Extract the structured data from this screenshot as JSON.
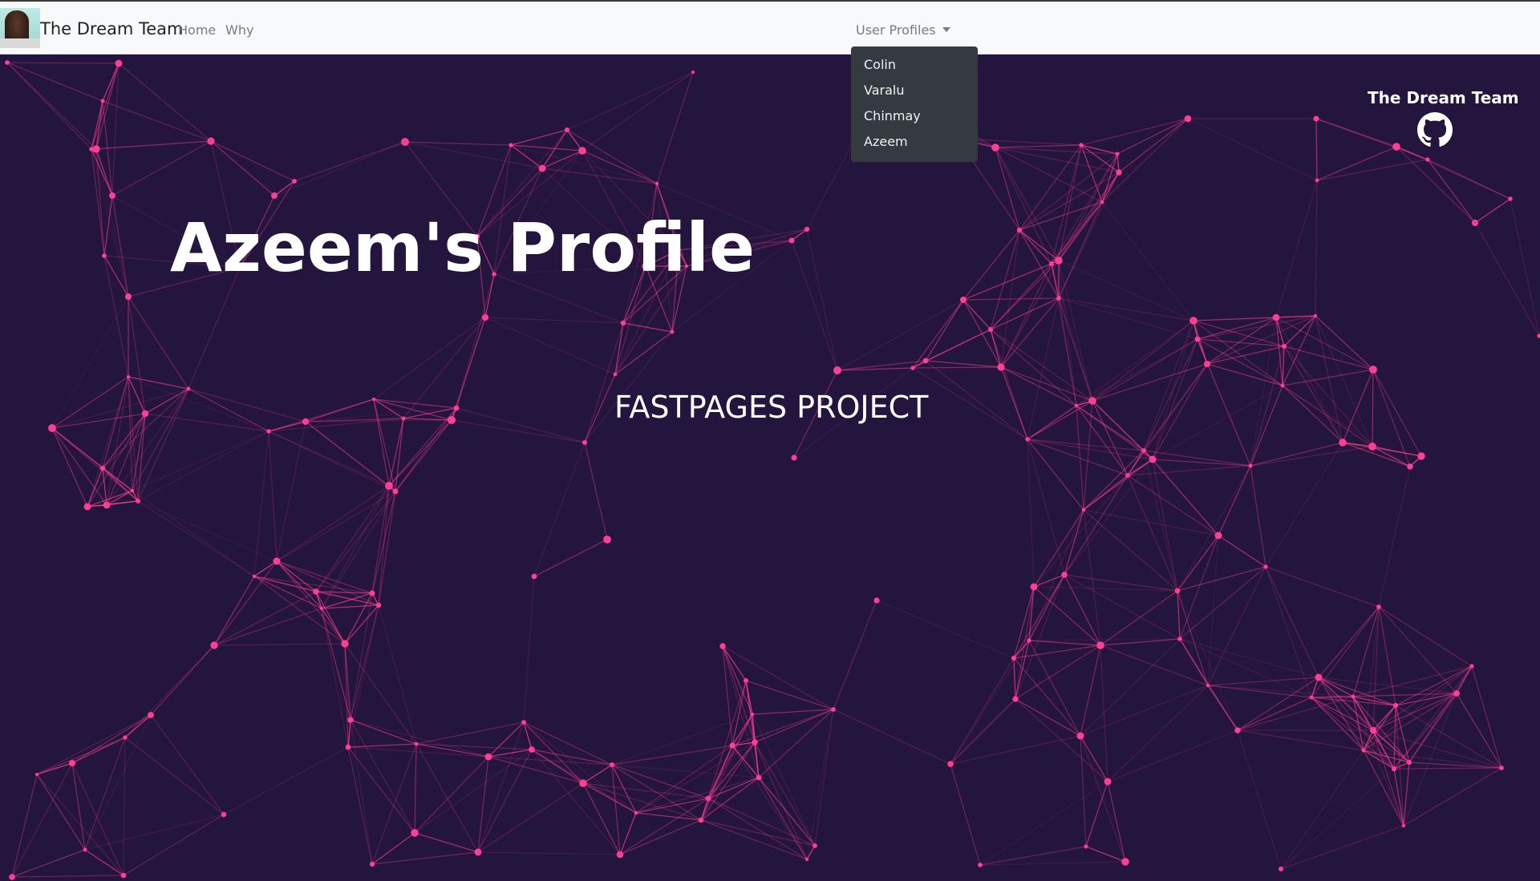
{
  "navbar": {
    "brand": "The Dream Team",
    "links": [
      "Home",
      "Why"
    ],
    "dropdown_label": "User Profiles",
    "dropdown_items": [
      "Colin",
      "Varalu",
      "Chinmay",
      "Azeem"
    ]
  },
  "hero": {
    "title": "Azeem's Profile",
    "subtitle": "FASTPAGES PROJECT",
    "team_name": "The Dream Team",
    "github_icon": "github-icon"
  },
  "colors": {
    "background": "#23153d",
    "network": "#ff3f93",
    "navbar": "#f8f9fa",
    "dropdown": "#343a40"
  }
}
